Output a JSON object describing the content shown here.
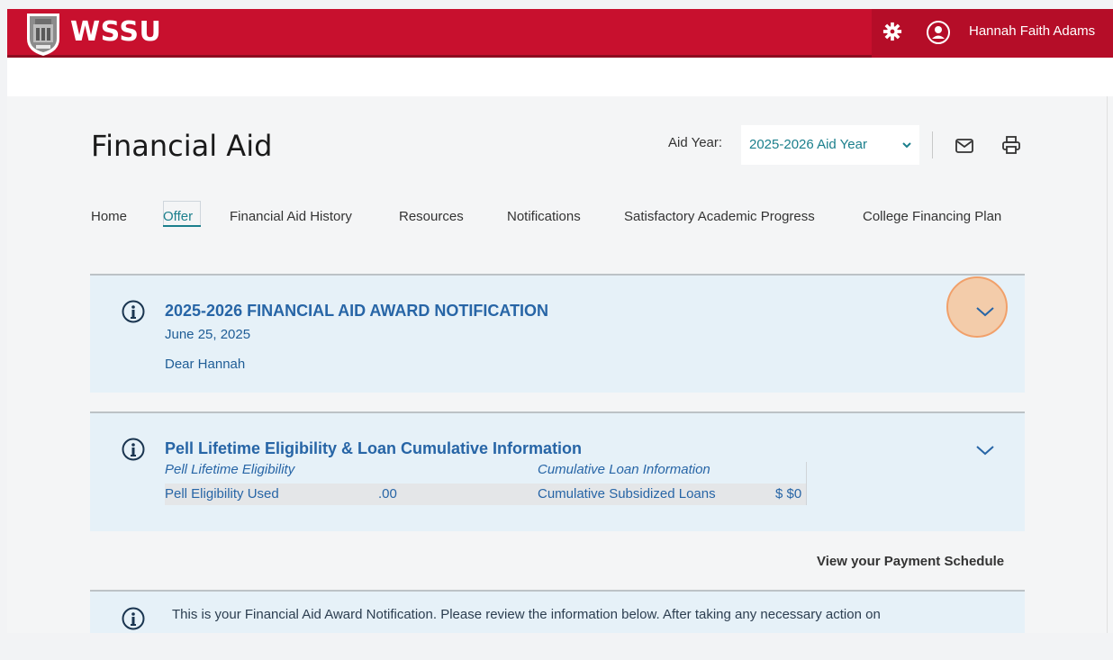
{
  "header": {
    "logo_text": "WSSU",
    "user_name": "Hannah Faith Adams",
    "brand_color": "#c8102e"
  },
  "page": {
    "title": "Financial Aid",
    "aid_year_label": "Aid Year:",
    "aid_year_value": "2025-2026 Aid Year"
  },
  "tabs": [
    {
      "label": "Home"
    },
    {
      "label": "Offer",
      "active": true
    },
    {
      "label": "Financial Aid History"
    },
    {
      "label": "Resources"
    },
    {
      "label": "Notifications"
    },
    {
      "label": "Satisfactory Academic Progress"
    },
    {
      "label": "College Financing Plan"
    }
  ],
  "award_notice": {
    "title": "2025-2026 FINANCIAL AID AWARD NOTIFICATION",
    "date": "June 25, 2025",
    "greeting": "Dear Hannah"
  },
  "pell_panel": {
    "title": "Pell Lifetime Eligibility & Loan Cumulative Information",
    "head_left": "Pell Lifetime Eligibility",
    "head_right": "Cumulative Loan Information",
    "row_label_left": "Pell Eligibility Used",
    "row_value_left": ".00",
    "row_label_right": "Cumulative Subsidized Loans",
    "row_value_right": "$ $0"
  },
  "payment_link": "View your Payment Schedule",
  "notice_text": "This is your Financial Aid Award Notification. Please review the information below. After taking any necessary action on",
  "colors": {
    "accent": "#1b7f8c",
    "panel_bg": "#e6f1f8",
    "link_blue": "#2765a6"
  }
}
